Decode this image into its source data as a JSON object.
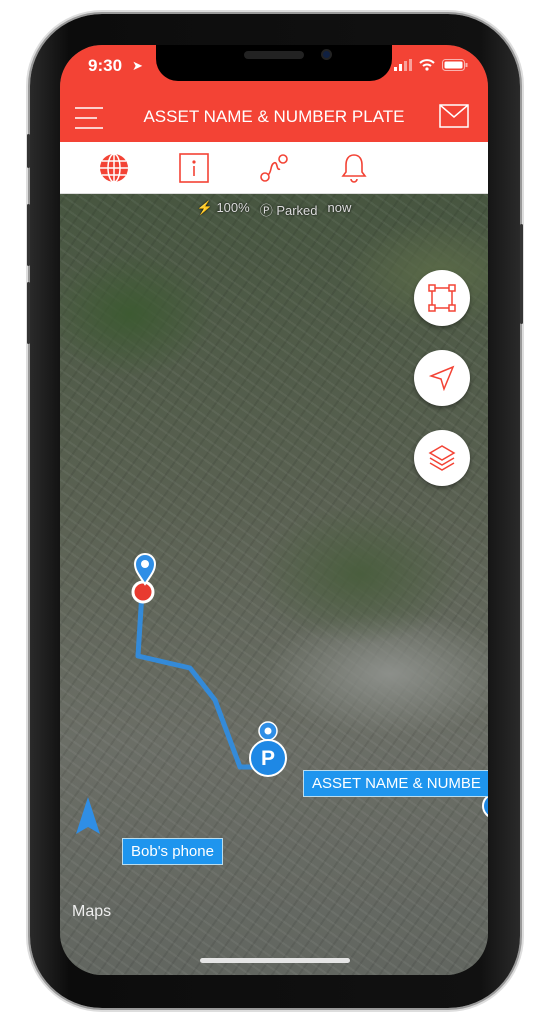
{
  "status_bar": {
    "time": "9:30"
  },
  "header": {
    "title": "ASSET NAME & NUMBER PLATE",
    "menu_icon": "hamburger-icon",
    "mail_icon": "mail-icon"
  },
  "tabs": [
    {
      "icon": "globe-icon",
      "active": true
    },
    {
      "icon": "info-icon"
    },
    {
      "icon": "route-icon"
    },
    {
      "icon": "bell-icon"
    }
  ],
  "info": {
    "battery": "100%",
    "status": "Parked",
    "updated": "now"
  },
  "map": {
    "controls": [
      {
        "icon": "fit-bounds-icon"
      },
      {
        "icon": "locate-icon"
      },
      {
        "icon": "layers-icon"
      }
    ],
    "labels": {
      "asset": "ASSET NAME & NUMBE",
      "phone": "Bob's phone"
    },
    "parking_marker": "P",
    "attribution": "Maps"
  },
  "colors": {
    "brand": "#f34335",
    "marker": "#1e95ee"
  }
}
